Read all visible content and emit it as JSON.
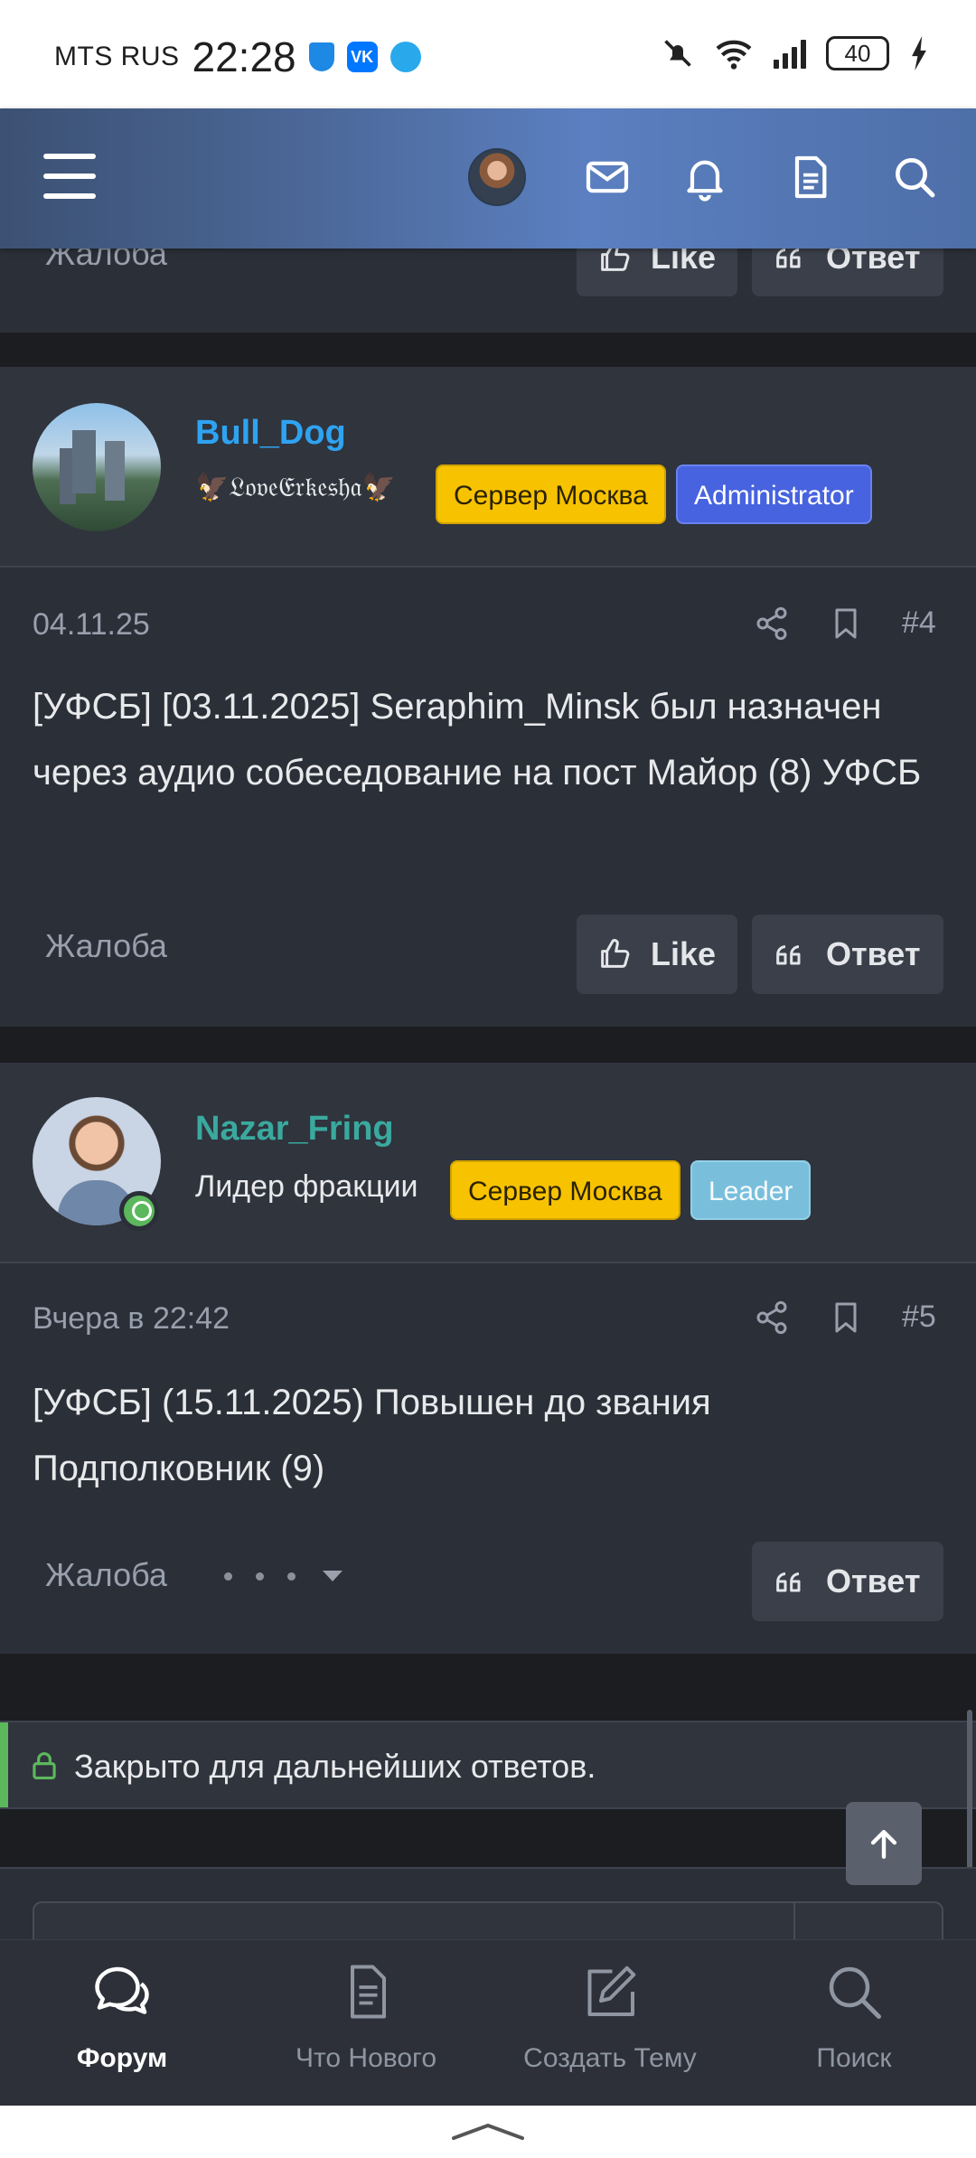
{
  "statusbar": {
    "carrier": "MTS RUS",
    "time": "22:28",
    "vk_label": "VK",
    "battery": "40"
  },
  "header": {
    "icons": [
      "menu-icon",
      "user-avatar",
      "mail-icon",
      "bell-icon",
      "document-icon",
      "search-icon"
    ]
  },
  "previous_post": {
    "report_label": "Жалоба",
    "like_label": "Like",
    "reply_label": "Ответ"
  },
  "posts": [
    {
      "username": "Bull_Dog",
      "username_color": "#2ea3f2",
      "user_title": "🦅𝔏𝔬𝔳𝔢𝔈𝔯𝔨𝔢𝔰𝔥𝔞🦅",
      "badges": [
        "Сервер Москва",
        "Administrator"
      ],
      "date": "04.11.25",
      "number": "#4",
      "body": "[УФСБ] [03.11.2025] Seraphim_Minsk был назначен через аудио собеседование на пост Майор (8) УФСБ",
      "report_label": "Жалоба",
      "like_label": "Like",
      "reply_label": "Ответ"
    },
    {
      "username": "Nazar_Fring",
      "username_color": "#3aa99f",
      "user_title": "Лидер фракции",
      "badges": [
        "Сервер Москва",
        "Leader"
      ],
      "date": "Вчера в 22:42",
      "number": "#5",
      "body": "[УФСБ] (15.11.2025) Повышен до звания Подполковник (9)",
      "report_label": "Жалоба",
      "reply_label": "Ответ"
    }
  ],
  "closed_notice": "Закрыто для дальнейших ответов.",
  "bottom_nav": [
    {
      "label": "Форум",
      "active": true
    },
    {
      "label": "Что Нового",
      "active": false
    },
    {
      "label": "Создать Тему",
      "active": false
    },
    {
      "label": "Поиск",
      "active": false
    }
  ],
  "colors": {
    "accent_green": "#5cb85c",
    "badge_yellow": "#f7c200",
    "badge_blue": "#4763df",
    "badge_light_blue": "#79bfdc"
  }
}
